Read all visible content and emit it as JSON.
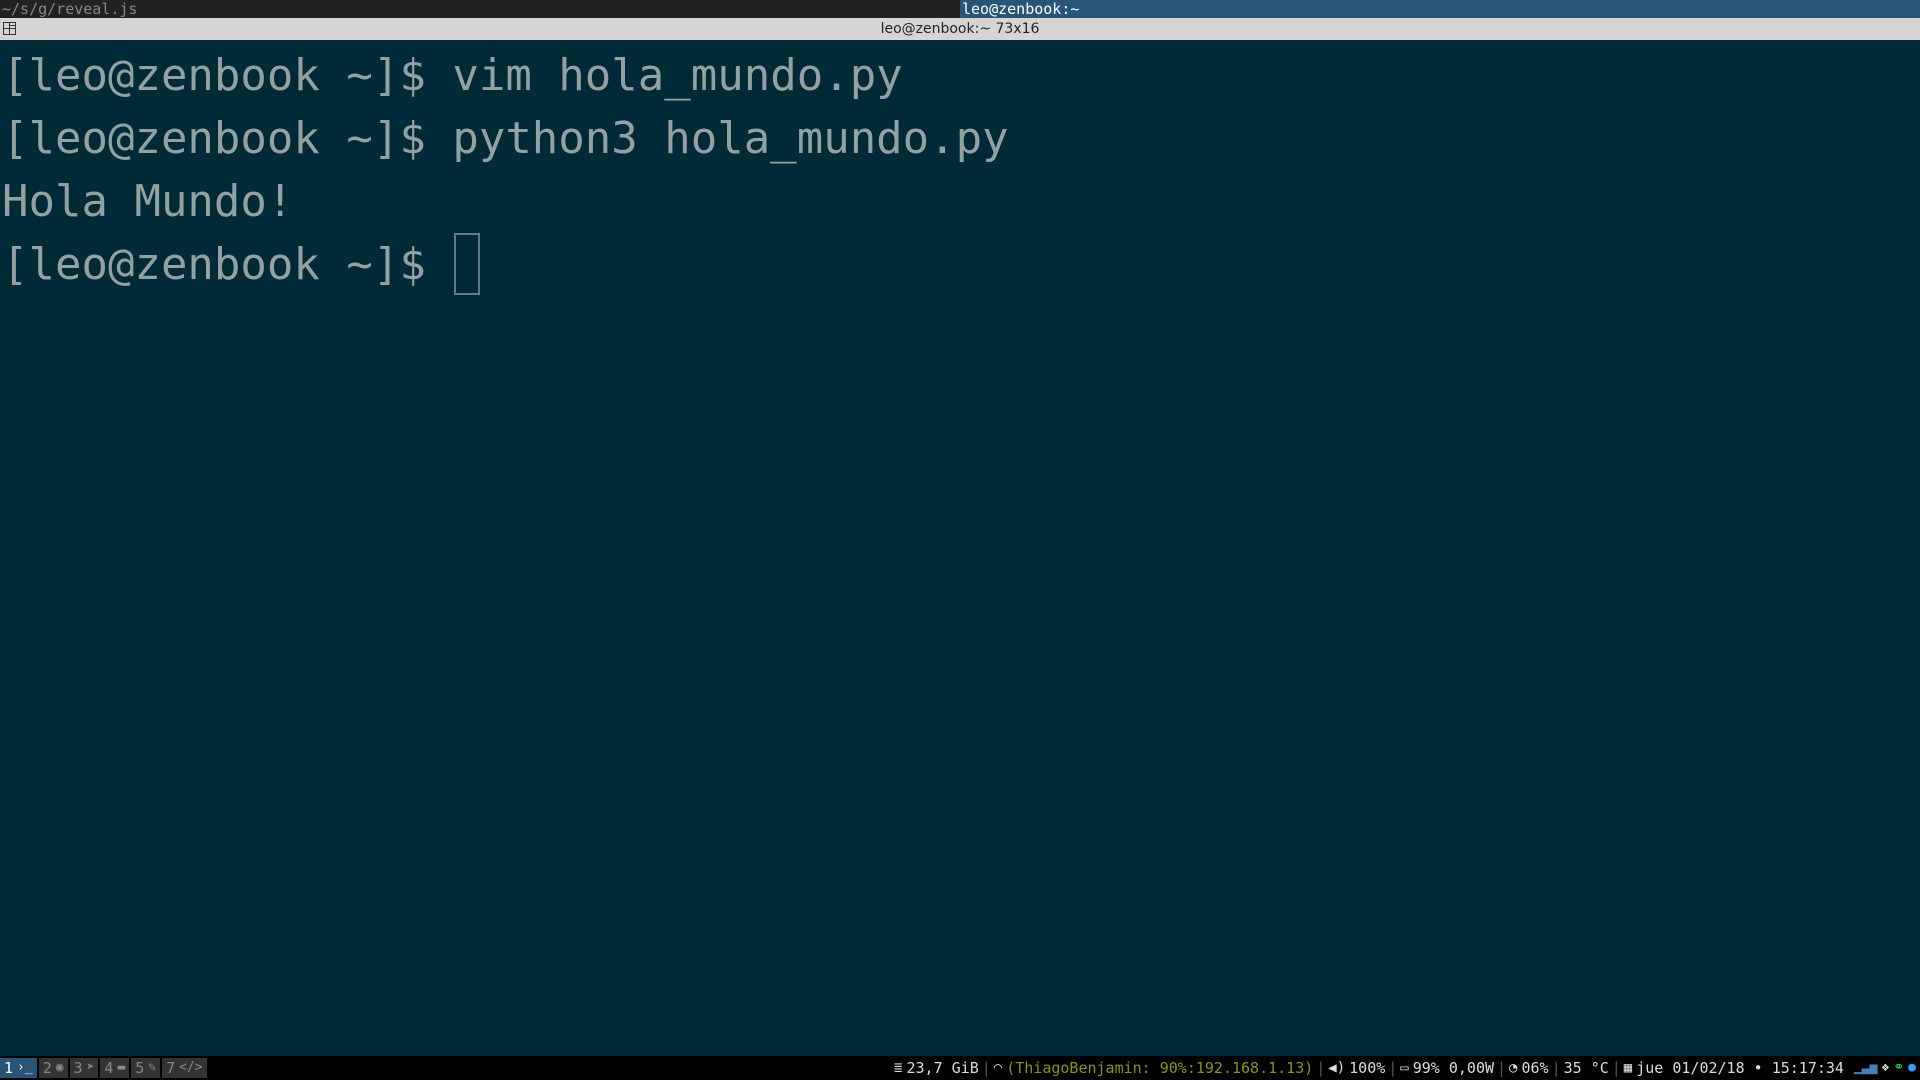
{
  "tabs": [
    {
      "label": "~/s/g/reveal.js",
      "active": false
    },
    {
      "label": "leo@zenbook:~",
      "active": true
    }
  ],
  "window": {
    "title": "leo@zenbook:~ 73x16"
  },
  "terminal": {
    "lines": [
      "[leo@zenbook ~]$ vim hola_mundo.py",
      "[leo@zenbook ~]$ python3 hola_mundo.py",
      "Hola Mundo!",
      "[leo@zenbook ~]$"
    ]
  },
  "workspaces": [
    {
      "number": "1",
      "icon": "terminal-icon",
      "glyph": "›_",
      "focused": true
    },
    {
      "number": "2",
      "icon": "firefox-icon",
      "glyph": "◉",
      "focused": false
    },
    {
      "number": "3",
      "icon": "telegram-icon",
      "glyph": "➤",
      "focused": false
    },
    {
      "number": "4",
      "icon": "folder-icon",
      "glyph": "▬",
      "focused": false
    },
    {
      "number": "5",
      "icon": "wrench-icon",
      "glyph": "✎",
      "focused": false
    },
    {
      "number": "7",
      "icon": "code-icon",
      "glyph": "</>",
      "focused": false
    }
  ],
  "status": {
    "disk": "23,7 GiB",
    "wifi": "(ThiagoBenjamin: 90%:192.168.1.13)",
    "volume": "100%",
    "battery": "99% 0,00W",
    "cpu": "06%",
    "temperature": "35 °C",
    "datetime": "jue 01/02/18 • 15:17:34"
  },
  "colors": {
    "terminal_bg": "#002b36",
    "terminal_fg": "#93a1a1",
    "focused_tab": "#285577",
    "wifi_green": "#859900"
  }
}
